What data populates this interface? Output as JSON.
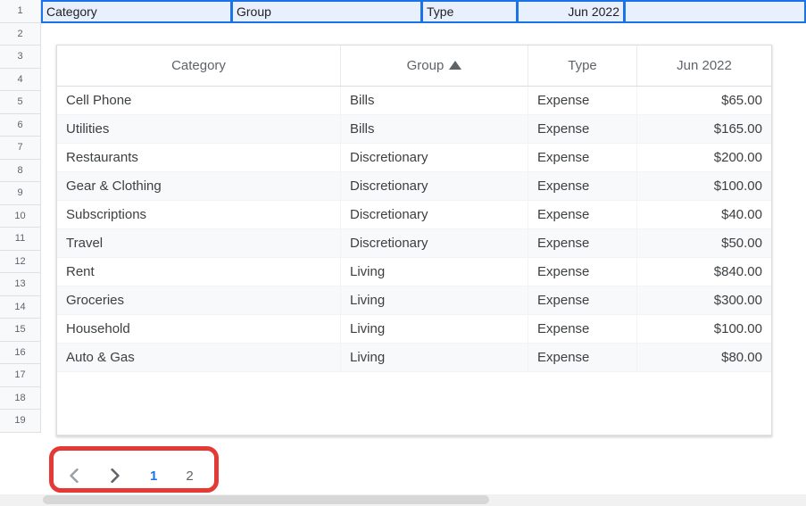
{
  "sheet": {
    "row_numbers": [
      "1",
      "2",
      "3",
      "4",
      "5",
      "6",
      "7",
      "8",
      "9",
      "10",
      "11",
      "12",
      "13",
      "14",
      "15",
      "16",
      "17",
      "18",
      "19"
    ],
    "header": {
      "c1": "Category",
      "c2": "Group",
      "c3": "Type",
      "c4": "Jun 2022"
    }
  },
  "overlay": {
    "columns": {
      "c1": "Category",
      "c2": "Group",
      "c3": "Type",
      "c4": "Jun 2022"
    },
    "sort_column": "c2",
    "rows": [
      {
        "category": "Cell Phone",
        "group": "Bills",
        "type": "Expense",
        "amount": "$65.00"
      },
      {
        "category": "Utilities",
        "group": "Bills",
        "type": "Expense",
        "amount": "$165.00"
      },
      {
        "category": "Restaurants",
        "group": "Discretionary",
        "type": "Expense",
        "amount": "$200.00"
      },
      {
        "category": "Gear & Clothing",
        "group": "Discretionary",
        "type": "Expense",
        "amount": "$100.00"
      },
      {
        "category": "Subscriptions",
        "group": "Discretionary",
        "type": "Expense",
        "amount": "$40.00"
      },
      {
        "category": "Travel",
        "group": "Discretionary",
        "type": "Expense",
        "amount": "$50.00"
      },
      {
        "category": "Rent",
        "group": "Living",
        "type": "Expense",
        "amount": "$840.00"
      },
      {
        "category": "Groceries",
        "group": "Living",
        "type": "Expense",
        "amount": "$300.00"
      },
      {
        "category": "Household",
        "group": "Living",
        "type": "Expense",
        "amount": "$100.00"
      },
      {
        "category": "Auto & Gas",
        "group": "Living",
        "type": "Expense",
        "amount": "$80.00"
      }
    ],
    "pagination": {
      "prev": "‹",
      "next": "›",
      "pages": [
        "1",
        "2"
      ],
      "active": "1"
    }
  }
}
